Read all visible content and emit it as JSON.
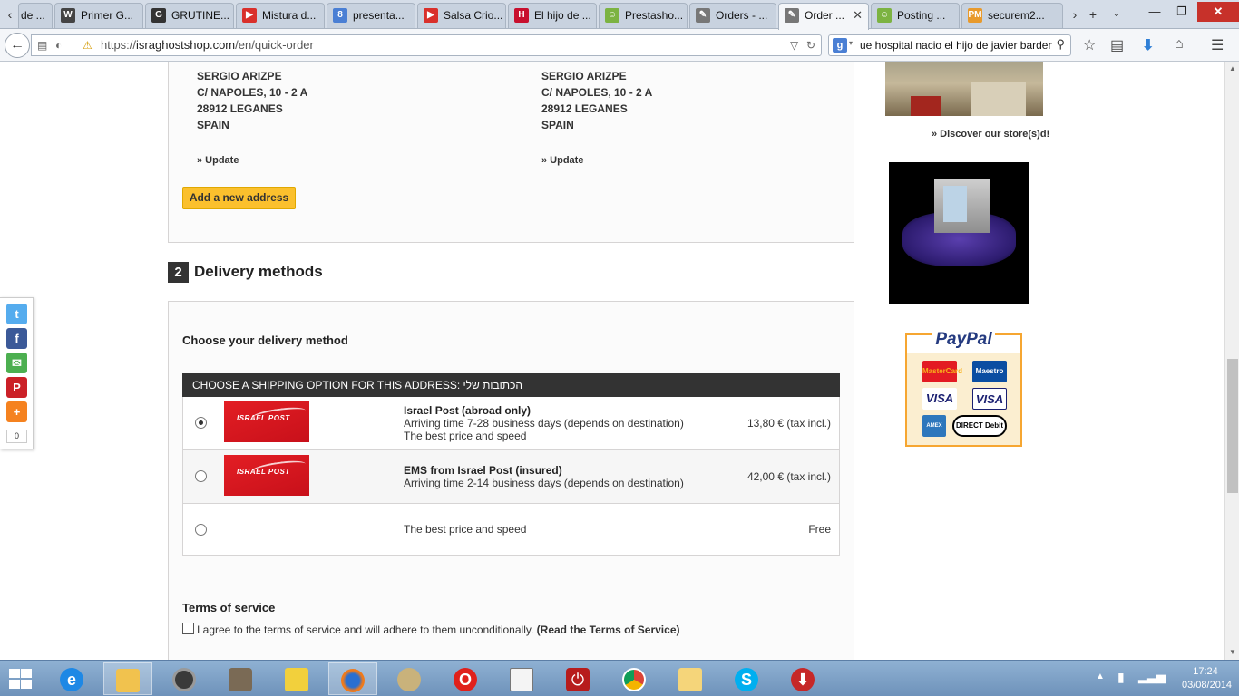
{
  "browser": {
    "tabs": [
      {
        "label": "de ...",
        "icon": "scroll-left",
        "color": "#999999"
      },
      {
        "label": "Primer G...",
        "icon": "W",
        "color": "#444444"
      },
      {
        "label": "GRUTINE...",
        "icon": "G",
        "color": "#333333"
      },
      {
        "label": "Mistura d...",
        "icon": "▶",
        "color": "#d9302b"
      },
      {
        "label": "presenta...",
        "icon": "8",
        "color": "#4a7fd4"
      },
      {
        "label": "Salsa Crio...",
        "icon": "▶",
        "color": "#d9302b"
      },
      {
        "label": "El hijo de ...",
        "icon": "H",
        "color": "#c8102e"
      },
      {
        "label": "Prestasho...",
        "icon": "☺",
        "color": "#7cb342"
      },
      {
        "label": "Orders - ...",
        "icon": "✎",
        "color": "#777777"
      },
      {
        "label": "Order ...",
        "icon": "✎",
        "color": "#777777"
      },
      {
        "label": "Posting ...",
        "icon": "☺",
        "color": "#7cb342"
      },
      {
        "label": "securem2...",
        "icon": "PM",
        "color": "#e89a2c"
      }
    ],
    "active_tab_close": "✕",
    "new_tab": "+",
    "url_prefix": "https://",
    "url_domain": "israghostshop.com",
    "url_path": "/en/quick-order",
    "search_value": "ue hospital nacio el hijo de javier barden"
  },
  "addresses": [
    {
      "name": "SERGIO ARIZPE",
      "street": "C/ NAPOLES, 10 - 2 A",
      "city": "28912 LEGANES",
      "country": "SPAIN",
      "update": "» Update"
    },
    {
      "name": "SERGIO ARIZPE",
      "street": "C/ NAPOLES, 10 - 2 A",
      "city": "28912 LEGANES",
      "country": "SPAIN",
      "update": "» Update"
    }
  ],
  "add_address_label": "Add a new address",
  "delivery": {
    "step_number": "2",
    "title": "Delivery methods",
    "choose_label": "Choose your delivery method",
    "shipping_header": "CHOOSE A SHIPPING OPTION FOR THIS ADDRESS: הכתובות שלי",
    "options": [
      {
        "name": "Israel Post (abroad only)",
        "desc1": "Arriving time 7-28 business days (depends on destination)",
        "desc2": "The best price and speed",
        "price": "13,80 € (tax incl.)",
        "selected": true,
        "logo_text": "ISRAEL POST"
      },
      {
        "name": "EMS from Israel Post (insured)",
        "desc1": "Arriving time 2-14 business days (depends on destination)",
        "desc2": "",
        "price": "42,00 € (tax incl.)",
        "selected": false,
        "logo_text": "ISRAEL POST"
      },
      {
        "name": "",
        "desc1": "The best price and speed",
        "desc2": "",
        "price": "Free",
        "selected": false,
        "logo_text": ""
      }
    ]
  },
  "terms": {
    "title": "Terms of service",
    "agree_text": "I agree to the terms of service and will adhere to them unconditionally.",
    "link_text": "(Read the Terms of Service)"
  },
  "sidebar_right": {
    "discover_label": "» Discover our store(s)d!",
    "paypal_title": "PayPal",
    "cards": [
      "MasterCard",
      "Maestro",
      "VISA",
      "VISA",
      "AMEX",
      "DIRECT Debit"
    ]
  },
  "share": {
    "count": "0"
  },
  "taskbar": {
    "time": "17:24",
    "date": "03/08/2014"
  }
}
